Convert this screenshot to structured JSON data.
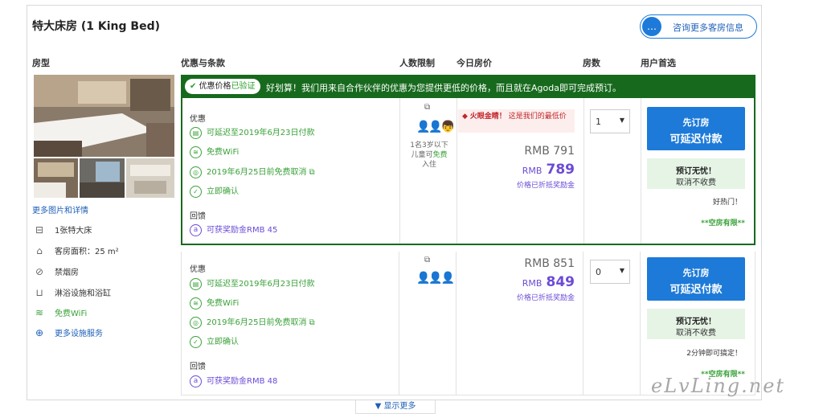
{
  "room": {
    "title": "特大床房 (1 King Bed)",
    "ask_label": "咨询更多客房信息"
  },
  "columns": [
    "房型",
    "优惠与条款",
    "人数限制",
    "今日房价",
    "房数",
    "用户首选"
  ],
  "banner": {
    "badge_prefix": "优惠价格",
    "badge_verified": "已验证",
    "text": "好划算！我们用来自合作伙伴的优惠为您提供更低的价格，而且就在Agoda即可完成预订。"
  },
  "room_info": {
    "more_photos": "更多图片和详情",
    "features": [
      {
        "icon": "bed-icon",
        "label": "1张特大床"
      },
      {
        "icon": "house-icon",
        "label": "客房面积：25 m²"
      },
      {
        "icon": "no-smoking-icon",
        "label": "禁烟房"
      },
      {
        "icon": "bathtub-icon",
        "label": "淋浴设施和浴缸"
      },
      {
        "icon": "wifi-icon",
        "label": "免费WiFi"
      },
      {
        "icon": "plus-circle-icon",
        "label": "更多设施服务"
      }
    ]
  },
  "offers": [
    {
      "benefits_heading": "优惠",
      "benefits": [
        "可延迟至2019年6月23日付款",
        "免费WiFi",
        "2019年6月25日前免费取消",
        "立即确认"
      ],
      "reward_heading": "回馈",
      "reward": "可获奖励金RMB 45",
      "occupancy_note": [
        "1名3岁以下",
        "儿童可",
        "免费",
        "入住"
      ],
      "deal_label": "火眼金睛！",
      "deal_text": "这是我们的最低价",
      "original_price": "RMB 791",
      "currency": "RMB",
      "price": "789",
      "price_note": "价格已折抵奖励金",
      "rooms": "1",
      "book_line1": "先订房",
      "book_line2": "可延迟付款",
      "worry_line1": "预订无忧！",
      "worry_line2": "取消不收费",
      "note": "好热门！",
      "availability": "**空房有限**"
    },
    {
      "benefits_heading": "优惠",
      "benefits": [
        "可延迟至2019年6月23日付款",
        "免费WiFi",
        "2019年6月25日前免费取消",
        "立即确认"
      ],
      "reward_heading": "回馈",
      "reward": "可获奖励金RMB 48",
      "original_price": "RMB 851",
      "currency": "RMB",
      "price": "849",
      "price_note": "价格已折抵奖励金",
      "rooms": "0",
      "book_line1": "先订房",
      "book_line2": "可延迟付款",
      "worry_line1": "预订无忧！",
      "worry_line2": "取消不收费",
      "note": "2分钟即可搞定！",
      "availability": "**空房有限**"
    }
  ],
  "show_more": "显示更多",
  "watermark": "eLvLing.net",
  "colors": {
    "brand_blue": "#1d7ad8",
    "banner_green": "#176a1d",
    "perk_green": "#3aa13a",
    "price_purple": "#6b4bd6"
  }
}
